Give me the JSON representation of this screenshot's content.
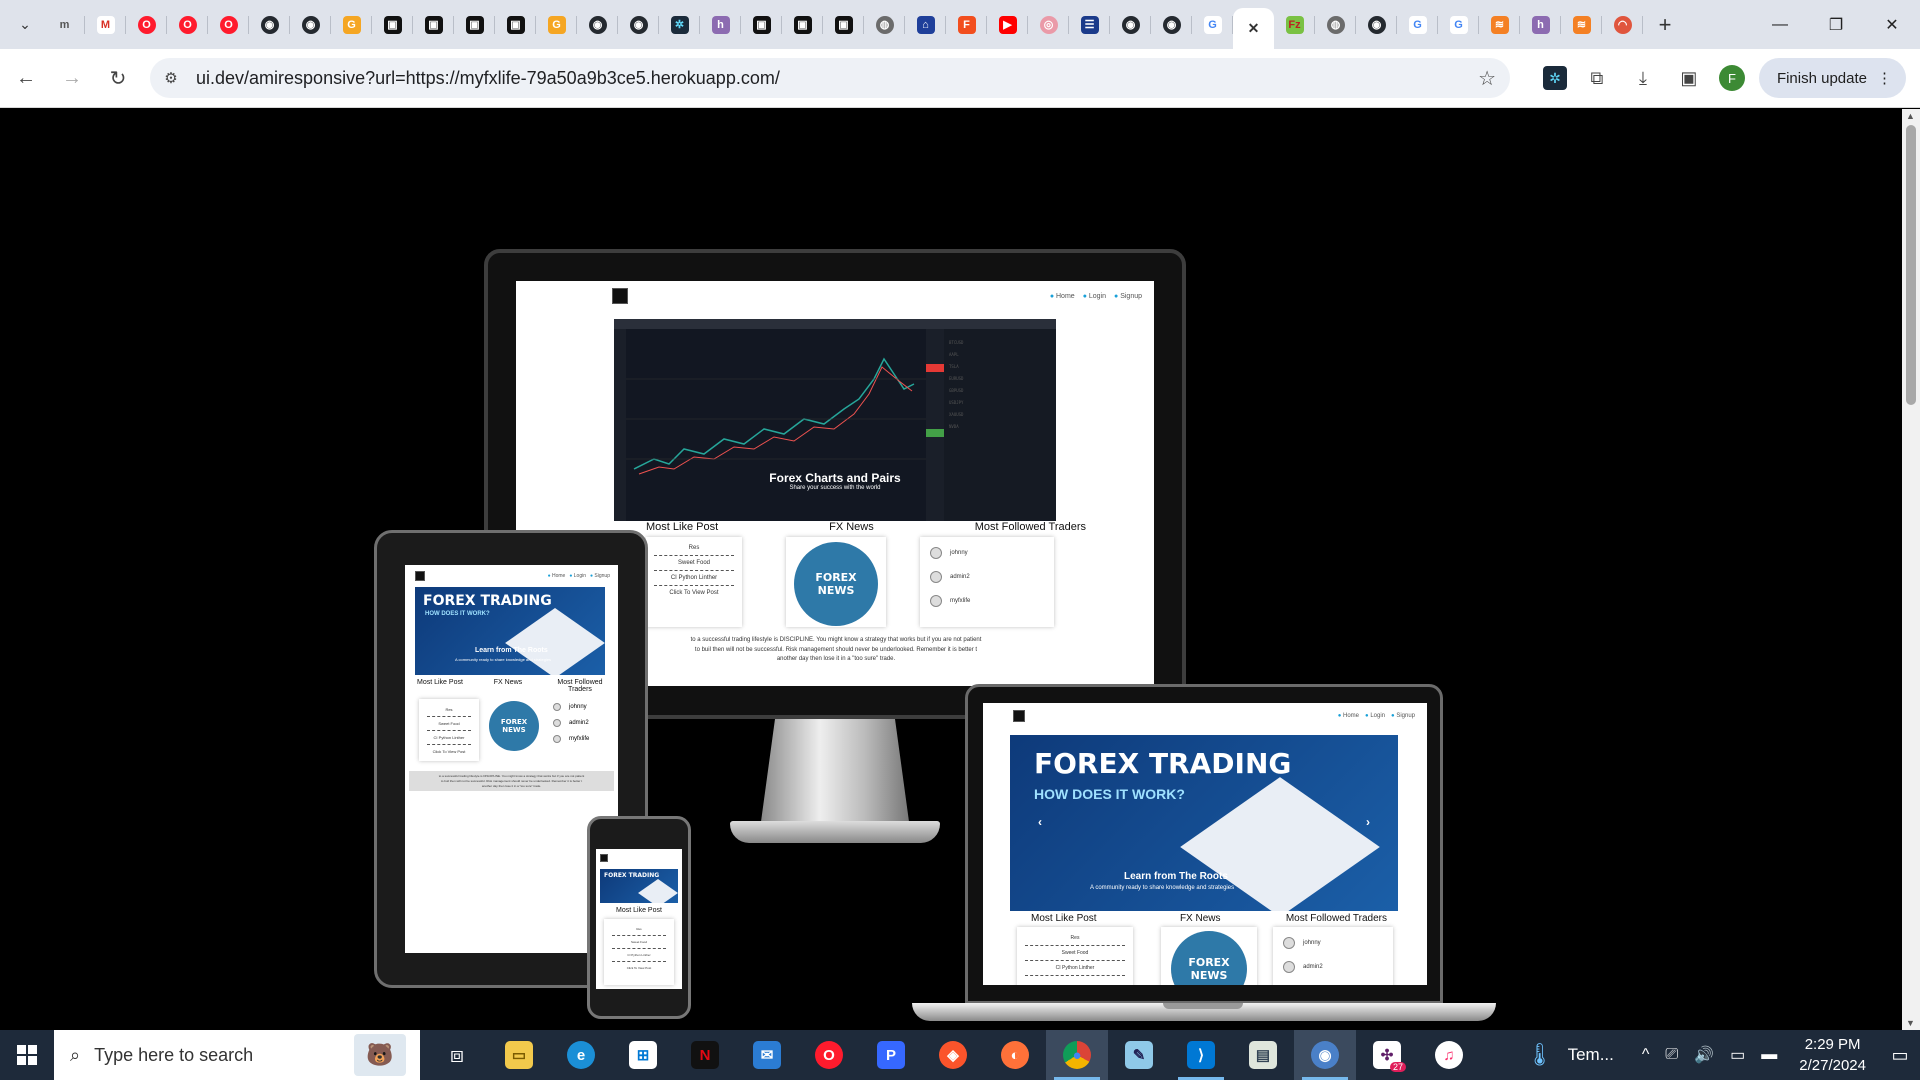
{
  "browser": {
    "tabs": [
      {
        "icon": "m-icon",
        "glyph": "m",
        "color": "#dfe3eb",
        "text_color": "#555"
      },
      {
        "icon": "gmail-icon",
        "glyph": "M",
        "color": "#ffffff",
        "text_color": "#d93025"
      },
      {
        "icon": "opera-icon",
        "glyph": "O",
        "color": "#ff1b2d",
        "text_color": "#fff"
      },
      {
        "icon": "opera-icon",
        "glyph": "O",
        "color": "#ff1b2d",
        "text_color": "#fff"
      },
      {
        "icon": "opera-icon",
        "glyph": "O",
        "color": "#ff1b2d",
        "text_color": "#fff"
      },
      {
        "icon": "github-icon",
        "glyph": "◉",
        "color": "#24292f",
        "text_color": "#fff"
      },
      {
        "icon": "github-icon",
        "glyph": "◉",
        "color": "#24292f",
        "text_color": "#fff"
      },
      {
        "icon": "grammarly-icon",
        "glyph": "G",
        "color": "#f5a623",
        "text_color": "#fff"
      },
      {
        "icon": "dashboard-icon",
        "glyph": "▣",
        "color": "#111",
        "text_color": "#fff"
      },
      {
        "icon": "dashboard-icon",
        "glyph": "▣",
        "color": "#111",
        "text_color": "#fff"
      },
      {
        "icon": "dashboard-icon",
        "glyph": "▣",
        "color": "#111",
        "text_color": "#fff"
      },
      {
        "icon": "dashboard-icon",
        "glyph": "▣",
        "color": "#111",
        "text_color": "#fff"
      },
      {
        "icon": "grammarly-icon",
        "glyph": "G",
        "color": "#f5a623",
        "text_color": "#fff"
      },
      {
        "icon": "github-icon",
        "glyph": "◉",
        "color": "#24292f",
        "text_color": "#fff"
      },
      {
        "icon": "github-icon",
        "glyph": "◉",
        "color": "#24292f",
        "text_color": "#fff"
      },
      {
        "icon": "react-icon",
        "glyph": "✲",
        "color": "#1a2a3a",
        "text_color": "#61dafb"
      },
      {
        "icon": "heroku-icon",
        "glyph": "h",
        "color": "#8c6bb1",
        "text_color": "#fff"
      },
      {
        "icon": "dashboard-icon",
        "glyph": "▣",
        "color": "#111",
        "text_color": "#fff"
      },
      {
        "icon": "dashboard-icon",
        "glyph": "▣",
        "color": "#111",
        "text_color": "#fff"
      },
      {
        "icon": "dashboard-icon",
        "glyph": "▣",
        "color": "#111",
        "text_color": "#fff"
      },
      {
        "icon": "globe-icon",
        "glyph": "◍",
        "color": "#6b6b6b",
        "text_color": "#fff"
      },
      {
        "icon": "library-icon",
        "glyph": "⌂",
        "color": "#1f3f9a",
        "text_color": "#fff"
      },
      {
        "icon": "figma-icon",
        "glyph": "F",
        "color": "#f24e1e",
        "text_color": "#fff"
      },
      {
        "icon": "youtube-icon",
        "glyph": "▶",
        "color": "#ff0000",
        "text_color": "#fff"
      },
      {
        "icon": "dribbble-icon",
        "glyph": "◎",
        "color": "#ea9aa8",
        "text_color": "#fff"
      },
      {
        "icon": "list-icon",
        "glyph": "☰",
        "color": "#1a3a8a",
        "text_color": "#fff"
      },
      {
        "icon": "github-icon",
        "glyph": "◉",
        "color": "#24292f",
        "text_color": "#fff"
      },
      {
        "icon": "github-icon",
        "glyph": "◉",
        "color": "#24292f",
        "text_color": "#fff"
      },
      {
        "icon": "google-icon",
        "glyph": "G",
        "color": "#ffffff",
        "text_color": "#4285f4"
      },
      {
        "icon": "close-icon",
        "glyph": "✕",
        "color": "#ffffff",
        "text_color": "#333",
        "active": true
      },
      {
        "icon": "filezilla-icon",
        "glyph": "Fz",
        "color": "#7ac143",
        "text_color": "#b22"
      },
      {
        "icon": "globe-icon",
        "glyph": "◍",
        "color": "#6b6b6b",
        "text_color": "#fff"
      },
      {
        "icon": "github-icon",
        "glyph": "◉",
        "color": "#24292f",
        "text_color": "#fff"
      },
      {
        "icon": "google-icon",
        "glyph": "G",
        "color": "#ffffff",
        "text_color": "#4285f4"
      },
      {
        "icon": "google-icon",
        "glyph": "G",
        "color": "#ffffff",
        "text_color": "#4285f4"
      },
      {
        "icon": "stack-icon",
        "glyph": "≋",
        "color": "#f48024",
        "text_color": "#fff"
      },
      {
        "icon": "heroku-icon",
        "glyph": "h",
        "color": "#8c6bb1",
        "text_color": "#fff"
      },
      {
        "icon": "stack-icon",
        "glyph": "≋",
        "color": "#f48024",
        "text_color": "#fff"
      },
      {
        "icon": "rainbow-icon",
        "glyph": "◠",
        "color": "#e0553d",
        "text_color": "#fff"
      }
    ],
    "new_tab_glyph": "+",
    "window_controls": {
      "minimize": "—",
      "restore": "❐",
      "close": "✕"
    },
    "url": "ui.dev/amiresponsive?url=https://myfxlife-79a50a9b3ce5.herokuapp.com/",
    "profile_initial": "F",
    "update_label": "Finish update"
  },
  "site": {
    "nav": {
      "home": "Home",
      "login": "Login",
      "signup": "Signup"
    },
    "chart_title": "Forex Charts and Pairs",
    "chart_subtitle": "Share your success with the world",
    "hero_title": "FOREX TRADING",
    "hero_subtitle": "HOW DOES IT WORK?",
    "hero_caption": "Learn from The Roots",
    "hero_caption_sub": "A community ready to share knowledge and strategies",
    "col_most_like": "Most Like Post",
    "col_fx_news": "FX News",
    "col_followed": "Most Followed Traders",
    "posts": [
      "Res",
      "Sweet Food",
      "CI Python Linther",
      "Click To View Post"
    ],
    "news_line1": "FOREX",
    "news_line2": "NEWS",
    "traders": [
      "johnny",
      "admin2",
      "myfxlife"
    ],
    "disclaimer_1": "to a successful trading lifestyle is DISCIPLINE. You might know a strategy that works but if you are not patient",
    "disclaimer_2": "to buil then will not be successful. Risk management should never be underlooked. Remember it is better t",
    "disclaimer_3": "another day then lose it in a \"too sure\" trade."
  },
  "taskbar": {
    "search_placeholder": "Type here to search",
    "temp_label": "Tem...",
    "time": "2:29 PM",
    "date": "2/27/2024",
    "badge": "27"
  }
}
